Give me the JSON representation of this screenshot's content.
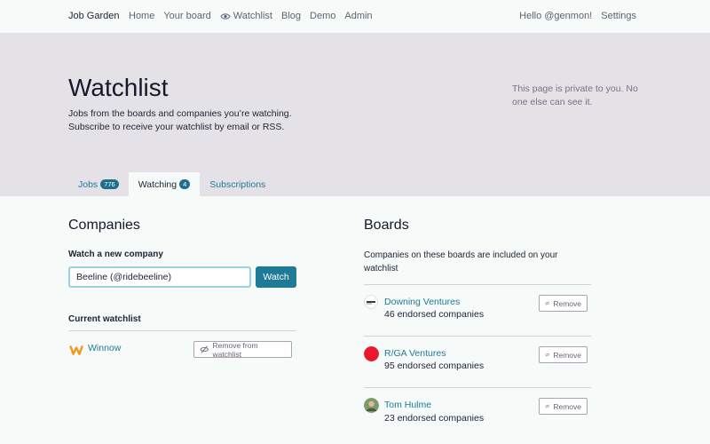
{
  "nav": {
    "brand": "Job Garden",
    "links": [
      "Home",
      "Your board",
      "Watchlist",
      "Blog",
      "Demo",
      "Admin"
    ],
    "greeting": "Hello @genmon!",
    "settings": "Settings"
  },
  "hero": {
    "title": "Watchlist",
    "subtitle_line1": "Jobs from the boards and companies you’re watching.",
    "subtitle_line2": "Subscribe to receive your watchlist by email or RSS.",
    "private_note": "This page is private to you. No one else can see it."
  },
  "tabs": [
    {
      "label": "Jobs",
      "badge": "776"
    },
    {
      "label": "Watching",
      "badge": "4"
    },
    {
      "label": "Subscriptions"
    }
  ],
  "companies": {
    "heading": "Companies",
    "watch_label": "Watch a new company",
    "input_value": "Beeline (@ridebeeline)",
    "watch_button": "Watch",
    "current_label": "Current watchlist",
    "items": [
      {
        "name": "Winnow",
        "remove_label": "Remove from watchlist"
      }
    ]
  },
  "boards": {
    "heading": "Boards",
    "description": "Companies on these boards are included on your watchlist",
    "items": [
      {
        "name": "Downing Ventures",
        "count": "46 endorsed companies",
        "remove_label": "Remove"
      },
      {
        "name": "R/GA Ventures",
        "count": "95 endorsed companies",
        "remove_label": "Remove"
      },
      {
        "name": "Tom Hulme",
        "count": "23 endorsed companies",
        "remove_label": "Remove"
      }
    ]
  },
  "colors": {
    "accent": "#1f7a98",
    "hero_bg": "#e4e2e7",
    "rga_red": "#e8192c"
  }
}
